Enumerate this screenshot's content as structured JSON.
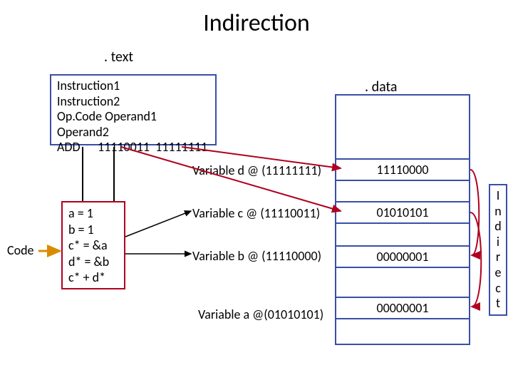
{
  "title": "Indirection",
  "sections": {
    "text": ". text",
    "data": ". data"
  },
  "instruction_box": {
    "lines": [
      "Instruction1",
      "Instruction2",
      "Op.Code Operand1 Operand2",
      "ADD      11110011  11111111"
    ]
  },
  "code_label": "Code",
  "code_box": {
    "lines": [
      "a = 1",
      "b = 1",
      "c* = &a",
      "d* = &b",
      "c* + d*"
    ]
  },
  "variables": {
    "d": "Variable d @ (11111111)",
    "c": "Variable c @ (11110011)",
    "b": "Variable b @ (11110000)",
    "a": "Variable a @(01010101)"
  },
  "memory": {
    "cells": [
      {
        "address_label": "d",
        "value": "11110000"
      },
      {
        "address_label": "c",
        "value": "01010101"
      },
      {
        "address_label": "b",
        "value": "00000001"
      },
      {
        "address_label": "a",
        "value": "00000001"
      }
    ]
  },
  "side_label_chars": [
    "I",
    "n",
    "d",
    "i",
    "r",
    "e",
    "c",
    "t"
  ],
  "chart_data": {
    "type": "diagram",
    "description": "Memory indirection: .text section contains ADD instruction with two operands that are addresses into .data; .data holds pointer variables c* and d* whose contents are the addresses of a and b; a and b hold the literal value 1.",
    "text_section": {
      "instruction": "ADD",
      "operand1": "11110011",
      "operand2": "11111111"
    },
    "data_section": [
      {
        "name": "d",
        "address": "11111111",
        "contents": "11110000",
        "points_to": "b"
      },
      {
        "name": "c",
        "address": "11110011",
        "contents": "01010101",
        "points_to": "a"
      },
      {
        "name": "b",
        "address": "11110000",
        "contents": "00000001"
      },
      {
        "name": "a",
        "address": "01010101",
        "contents": "00000001"
      }
    ],
    "source_code": [
      "a = 1",
      "b = 1",
      "c* = &a",
      "d* = &b",
      "c* + d*"
    ]
  }
}
